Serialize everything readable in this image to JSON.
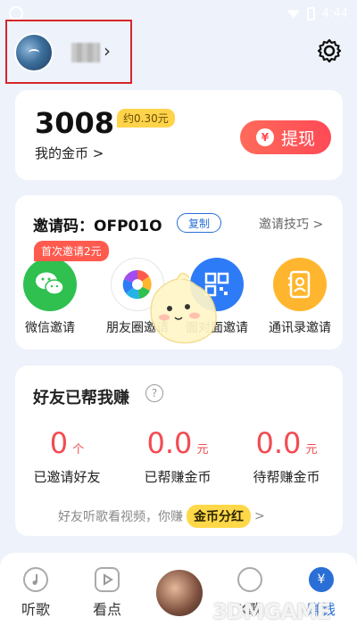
{
  "status_bar": {
    "time": "4:44"
  },
  "coin_card": {
    "count": "3008",
    "approx": "约0.30元",
    "label": "我的金币 >",
    "withdraw_label": "提现",
    "withdraw_icon": "¥"
  },
  "invite_card": {
    "title": "邀请码：OFP01O",
    "copy_label": "复制",
    "tips_label": "邀请技巧 >",
    "badge": "首次邀请2元",
    "items": [
      {
        "label": "微信邀请",
        "icon": "wechat-icon",
        "color": "#2fc04f"
      },
      {
        "label": "朋友圈邀请",
        "icon": "moments-icon",
        "color": "#ffffff"
      },
      {
        "label": "面对面邀请",
        "icon": "qrcode-icon",
        "color": "#2d7bf6"
      },
      {
        "label": "通讯录邀请",
        "icon": "contacts-icon",
        "color": "#ffb62e"
      }
    ]
  },
  "friends_card": {
    "title": "好友已帮我赚",
    "help": "?",
    "stats": [
      {
        "value": "0",
        "unit": "个",
        "label": "已邀请好友"
      },
      {
        "value": "0.0",
        "unit": "元",
        "label": "已帮赚金币"
      },
      {
        "value": "0.0",
        "unit": "元",
        "label": "待帮赚金币"
      }
    ],
    "footer_text": "好友听歌看视频，你赚",
    "footer_tag": "金币分红",
    "footer_chevron": ">"
  },
  "tabbar": {
    "tabs": [
      {
        "label": "听歌",
        "icon": "music-note-icon"
      },
      {
        "label": "看点",
        "icon": "play-icon"
      },
      {
        "label": "",
        "icon": "now-playing-disc"
      },
      {
        "label": "K歌",
        "icon": "microphone-icon"
      },
      {
        "label": "赚钱",
        "icon": "yen-icon"
      }
    ]
  },
  "watermark": "3DMGAME",
  "colors": {
    "accent_red": "#f24b52",
    "accent_blue": "#2a6fd6",
    "coin_tag": "#ffd34a",
    "highlight_box": "#d6262c"
  }
}
